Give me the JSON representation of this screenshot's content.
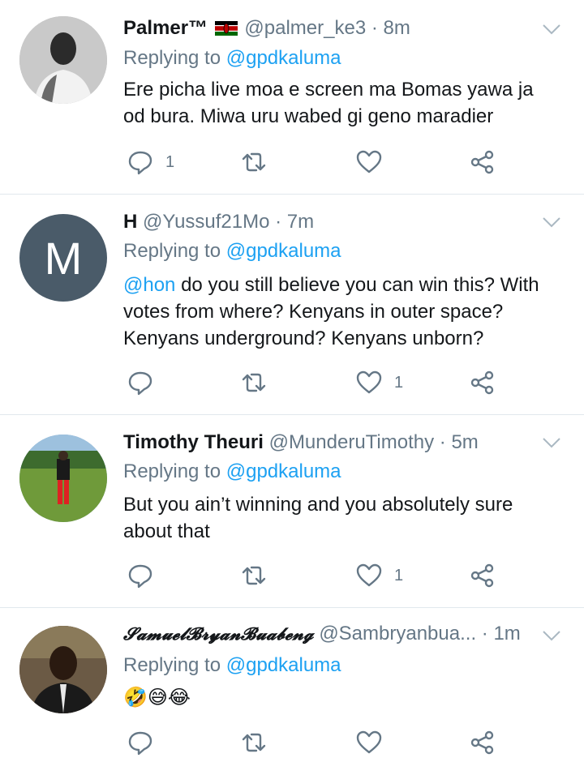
{
  "tweets": [
    {
      "name": "Palmer™",
      "handle": "@palmer_ke3",
      "time": "· 8m",
      "replying_prefix": "Replying to",
      "replying_to": "@gpdkaluma",
      "text": "Ere picha live moa e screen ma Bomas yawa ja od bura. Miwa uru wabed gi geno maradier",
      "reply_count": "1",
      "like_count": "",
      "avatar_icon": "person-photo-avatar"
    },
    {
      "name": "H",
      "handle": "@Yussuf21Mo",
      "time": "· 7m",
      "replying_prefix": "Replying to",
      "replying_to": "@gpdkaluma",
      "mention": "@hon",
      "text": " do you still believe you can win this? With votes from where? Kenyans in outer space? Kenyans underground? Kenyans unborn?",
      "reply_count": "",
      "like_count": "1",
      "avatar_letter": "M"
    },
    {
      "name": "Timothy Theuri",
      "handle": "@MunderuTimothy",
      "time": "· 5m",
      "replying_prefix": "Replying to",
      "replying_to": "@gpdkaluma",
      "text": "But you ain’t winning and you absolutely sure about that",
      "reply_count": "",
      "like_count": "1",
      "avatar_icon": "person-on-field-avatar"
    },
    {
      "name": "𝓢𝓪𝓶𝓾𝓮𝓵𝓑𝓻𝔂𝓪𝓷𝓑𝓾𝓪𝓫𝓮𝓷𝓰",
      "handle": "@Sambryanbua...",
      "time": "· 1m",
      "replying_prefix": "Replying to",
      "replying_to": "@gpdkaluma",
      "text": "🤣😅😂",
      "reply_count": "",
      "like_count": "",
      "avatar_icon": "person-suit-avatar"
    }
  ],
  "colors": {
    "link": "#1da1f2",
    "muted": "#657786",
    "border": "#e1e8ed"
  }
}
